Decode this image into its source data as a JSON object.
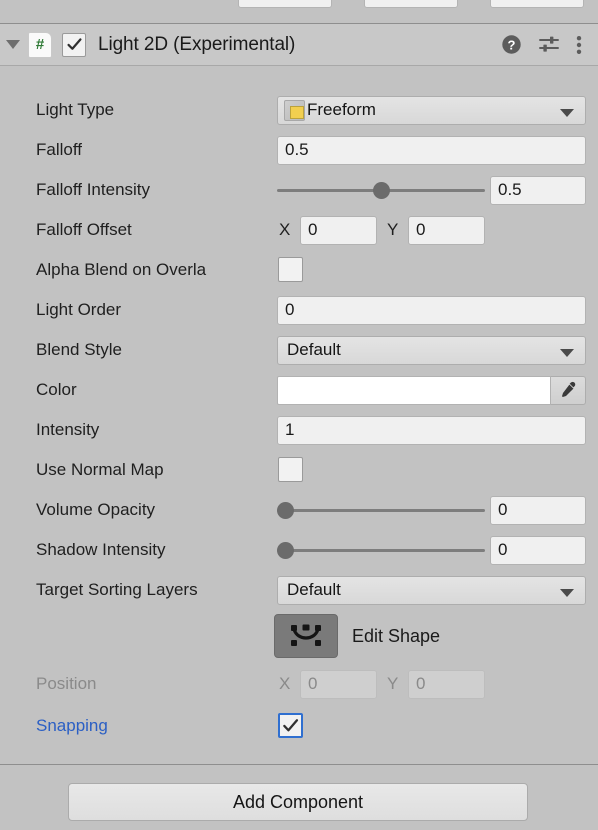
{
  "theme": {
    "background": "#c2c2c2",
    "header_background": "#c8c8c8",
    "field_background": "#f0f0f0",
    "accent_blue": "#2b5fc4",
    "script_icon_green": "#2f7a36"
  },
  "top_partial_fields": [
    {
      "name": "partial-field-1"
    },
    {
      "name": "partial-field-2"
    },
    {
      "name": "partial-field-3"
    }
  ],
  "component_header": {
    "title": "Light 2D (Experimental)",
    "script_glyph": "#",
    "enabled": true,
    "foldout_expanded": true,
    "icons": [
      {
        "name": "help-icon",
        "label": "?"
      },
      {
        "name": "preset-icon",
        "label": "Preset"
      },
      {
        "name": "more-menu-icon",
        "label": "More"
      }
    ]
  },
  "rows": {
    "light_type": {
      "label": "Light Type",
      "value": "Freeform"
    },
    "falloff": {
      "label": "Falloff",
      "value": "0.5"
    },
    "falloff_intensity": {
      "label": "Falloff Intensity",
      "value": "0.5",
      "slider_pct": 50
    },
    "falloff_offset": {
      "label": "Falloff Offset",
      "x_label": "X",
      "x_value": "0",
      "y_label": "Y",
      "y_value": "0"
    },
    "alpha_blend_on_overlap": {
      "label": "Alpha Blend on Overla",
      "checked": false
    },
    "light_order": {
      "label": "Light Order",
      "value": "0"
    },
    "blend_style": {
      "label": "Blend Style",
      "value": "Default"
    },
    "color": {
      "label": "Color",
      "value": "#ffffff"
    },
    "intensity": {
      "label": "Intensity",
      "value": "1"
    },
    "use_normal_map": {
      "label": "Use Normal Map",
      "checked": false
    },
    "volume_opacity": {
      "label": "Volume Opacity",
      "value": "0",
      "slider_pct": 0
    },
    "shadow_intensity": {
      "label": "Shadow Intensity",
      "value": "0",
      "slider_pct": 0
    },
    "target_sorting_layers": {
      "label": "Target Sorting Layers",
      "value": "Default"
    },
    "edit_shape": {
      "label": "Edit Shape",
      "active": true
    },
    "position": {
      "label": "Position",
      "x_label": "X",
      "x_value": "0",
      "y_label": "Y",
      "y_value": "0",
      "disabled": true
    },
    "snapping": {
      "label": "Snapping",
      "checked": true
    }
  },
  "footer": {
    "add_component_label": "Add Component"
  }
}
